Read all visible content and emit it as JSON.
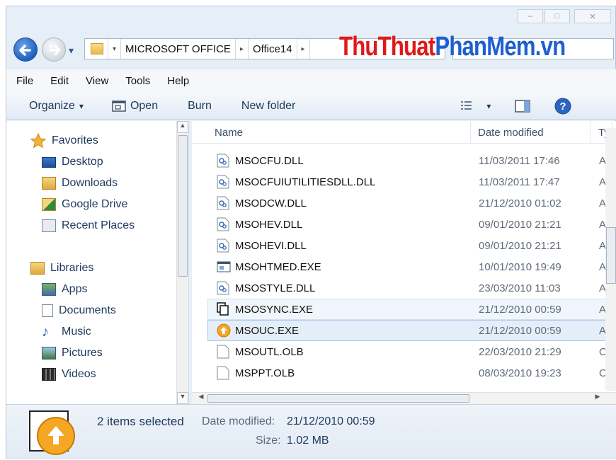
{
  "window": {
    "min_glyph": "–",
    "max_glyph": "□",
    "close_glyph": "✕"
  },
  "address": {
    "crumbs": [
      "MICROSOFT OFFICE",
      "Office14"
    ],
    "arrow": "▸",
    "dropdown": "▾"
  },
  "watermark": {
    "part1": "ThuThuat",
    "part2": "PhanMem.vn"
  },
  "menu": {
    "items": [
      "File",
      "Edit",
      "View",
      "Tools",
      "Help"
    ]
  },
  "toolbar": {
    "organize": "Organize",
    "organize_arrow": "▾",
    "open": "Open",
    "burn": "Burn",
    "new_folder": "New folder",
    "view_arrow": "▾"
  },
  "nav": {
    "favorites": "Favorites",
    "fav_items": [
      "Desktop",
      "Downloads",
      "Google Drive",
      "Recent Places"
    ],
    "libraries": "Libraries",
    "lib_items": [
      "Apps",
      "Documents",
      "Music",
      "Pictures",
      "Videos"
    ]
  },
  "columns": {
    "name": "Name",
    "date": "Date modified",
    "type": "Ty"
  },
  "files": [
    {
      "name": "MSOCFU.DLL",
      "date": "11/03/2011 17:46",
      "type": "Ap",
      "icon": "dll-icon"
    },
    {
      "name": "MSOCFUIUTILITIESDLL.DLL",
      "date": "11/03/2011 17:47",
      "type": "Ap",
      "icon": "dll-icon"
    },
    {
      "name": "MSODCW.DLL",
      "date": "21/12/2010 01:02",
      "type": "Ap",
      "icon": "dll-icon"
    },
    {
      "name": "MSOHEV.DLL",
      "date": "09/01/2010 21:21",
      "type": "Ap",
      "icon": "dll-icon"
    },
    {
      "name": "MSOHEVI.DLL",
      "date": "09/01/2010 21:21",
      "type": "Ap",
      "icon": "dll-icon"
    },
    {
      "name": "MSOHTMED.EXE",
      "date": "10/01/2010 19:49",
      "type": "Ap",
      "icon": "exe-icon"
    },
    {
      "name": "MSOSTYLE.DLL",
      "date": "23/03/2010 11:03",
      "type": "Ap",
      "icon": "dll-icon"
    },
    {
      "name": "MSOSYNC.EXE",
      "date": "21/12/2010 00:59",
      "type": "Ap",
      "icon": "sync-icon"
    },
    {
      "name": "MSOUC.EXE",
      "date": "21/12/2010 00:59",
      "type": "Ap",
      "icon": "upload-center-icon"
    },
    {
      "name": "MSOUTL.OLB",
      "date": "22/03/2010 21:29",
      "type": "Ol",
      "icon": "blank-file-icon"
    },
    {
      "name": "MSPPT.OLB",
      "date": "08/03/2010 19:23",
      "type": "Ol",
      "icon": "blank-file-icon"
    }
  ],
  "details": {
    "count": "2 items selected",
    "date_label": "Date modified:",
    "date_value": "21/12/2010 00:59",
    "size_label": "Size:",
    "size_value": "1.02 MB"
  }
}
